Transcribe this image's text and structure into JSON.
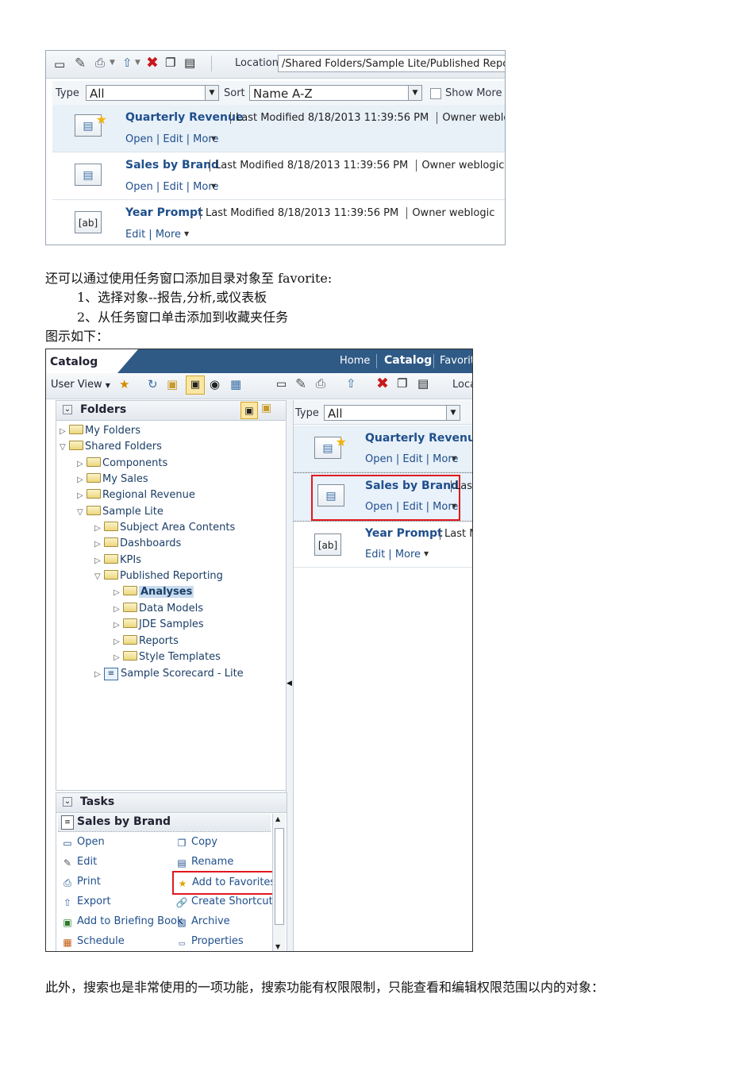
{
  "top_shot": {
    "location_label": "Location",
    "location_path": "/Shared Folders/Sample Lite/Published Reporting,",
    "type_label": "Type",
    "type_value": "All",
    "sort_label": "Sort",
    "sort_value": "Name A-Z",
    "show_more_label": "Show More D",
    "items": [
      {
        "title": "Quarterly Revenue",
        "meta": "Last Modified 8/18/2013 11:39:56 PM",
        "owner": "Owner weblogic",
        "actions": "Open | Edit | More",
        "icon": "report-star-icon"
      },
      {
        "title": "Sales by Brand",
        "meta": "Last Modified 8/18/2013 11:39:56 PM",
        "owner": "Owner weblogic",
        "actions": "Open | Edit | More",
        "icon": "analysis-icon"
      },
      {
        "title": "Year Prompt",
        "meta": "Last Modified 8/18/2013 11:39:56 PM",
        "owner": "Owner weblogic",
        "actions": "Edit | More",
        "icon": "prompt-icon",
        "icon_text": "[ab]"
      }
    ]
  },
  "text": {
    "para1": "还可以通过使用任务窗口添加目录对象至 favorite:",
    "step1": "1、选择对象--报告,分析,或仪表板",
    "step2": "2、从任务窗口单击添加到收藏夹任务",
    "caption": "图示如下：",
    "para_bottom": "此外，搜索也是非常使用的一项功能，搜索功能有权限限制，只能查看和编辑权限范围以内的对象："
  },
  "bottom_shot": {
    "app_title": "Catalog",
    "nav": [
      "Home",
      "Catalog",
      "Favorit"
    ],
    "view_label": "User View",
    "loc_fragment": "Loca",
    "folders_title": "Folders",
    "tree": [
      {
        "label": "My Folders",
        "indent": 0,
        "open": false
      },
      {
        "label": "Shared Folders",
        "indent": 0,
        "open": true
      },
      {
        "label": "Components",
        "indent": 1,
        "open": false
      },
      {
        "label": "My Sales",
        "indent": 1,
        "open": false
      },
      {
        "label": "Regional Revenue",
        "indent": 1,
        "open": false
      },
      {
        "label": "Sample Lite",
        "indent": 1,
        "open": true
      },
      {
        "label": "Subject Area Contents",
        "indent": 2,
        "open": false
      },
      {
        "label": "Dashboards",
        "indent": 2,
        "open": false
      },
      {
        "label": "KPIs",
        "indent": 2,
        "open": false
      },
      {
        "label": "Published Reporting",
        "indent": 2,
        "open": true
      },
      {
        "label": "Analyses",
        "indent": 3,
        "open": false,
        "selected": true
      },
      {
        "label": "Data Models",
        "indent": 3,
        "open": false
      },
      {
        "label": "JDE Samples",
        "indent": 3,
        "open": false
      },
      {
        "label": "Reports",
        "indent": 3,
        "open": false
      },
      {
        "label": "Style Templates",
        "indent": 3,
        "open": false
      },
      {
        "label": "Sample Scorecard - Lite",
        "indent": 2,
        "open": false
      }
    ],
    "type_label": "Type",
    "type_value": "All",
    "items": [
      {
        "title": "Quarterly Revenue",
        "actions": "Open | Edit | More"
      },
      {
        "title": "Sales by Brand",
        "actions": "Open | Edit | More",
        "meta_fragment": "Las"
      },
      {
        "title": "Year Prompt",
        "actions": "Edit | More",
        "meta_fragment": "Last M",
        "icon_text": "[ab]"
      }
    ],
    "tasks_title": "Tasks",
    "tasks_object": "Sales by Brand",
    "tasks_left": [
      "Open",
      "Edit",
      "Print",
      "Export",
      "Add to Briefing Book",
      "Schedule"
    ],
    "tasks_right": [
      "Copy",
      "Rename",
      "Add to Favorites",
      "Create Shortcut",
      "Archive",
      "Properties"
    ],
    "highlight_color": "#e0191e"
  }
}
